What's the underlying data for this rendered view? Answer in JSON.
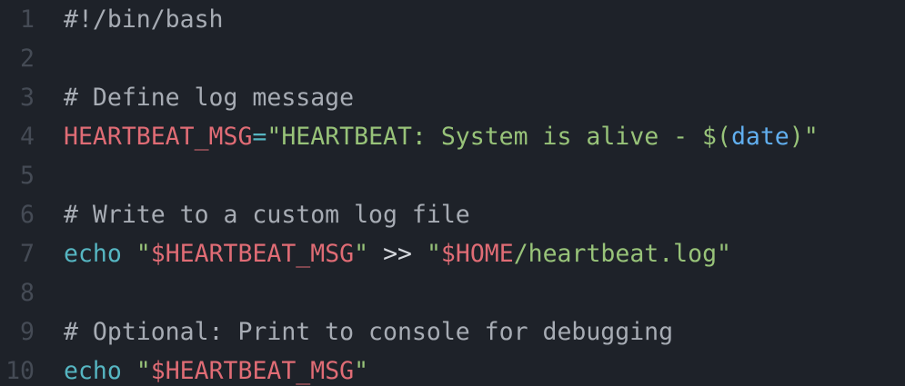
{
  "editor": {
    "lines": [
      {
        "num": "1",
        "tokens": [
          {
            "t": "#!/bin/bash",
            "c": "comment"
          }
        ]
      },
      {
        "num": "2",
        "tokens": []
      },
      {
        "num": "3",
        "tokens": [
          {
            "t": "# Define log message",
            "c": "comment"
          }
        ]
      },
      {
        "num": "4",
        "tokens": [
          {
            "t": "HEARTBEAT_MSG",
            "c": "var"
          },
          {
            "t": "=",
            "c": "op"
          },
          {
            "t": "\"HEARTBEAT: System is alive - $(",
            "c": "str"
          },
          {
            "t": "date",
            "c": "fn"
          },
          {
            "t": ")\"",
            "c": "str"
          }
        ]
      },
      {
        "num": "5",
        "tokens": []
      },
      {
        "num": "6",
        "tokens": [
          {
            "t": "# Write to a custom log file",
            "c": "comment"
          }
        ]
      },
      {
        "num": "7",
        "tokens": [
          {
            "t": "echo",
            "c": "kw"
          },
          {
            "t": " ",
            "c": "plain"
          },
          {
            "t": "\"",
            "c": "str"
          },
          {
            "t": "$HEARTBEAT_MSG",
            "c": "var"
          },
          {
            "t": "\"",
            "c": "str"
          },
          {
            "t": " >> ",
            "c": "plain"
          },
          {
            "t": "\"",
            "c": "str"
          },
          {
            "t": "$HOME",
            "c": "var"
          },
          {
            "t": "/heartbeat.log\"",
            "c": "str"
          }
        ]
      },
      {
        "num": "8",
        "tokens": []
      },
      {
        "num": "9",
        "tokens": [
          {
            "t": "# Optional: Print to console for debugging",
            "c": "comment"
          }
        ]
      },
      {
        "num": "10",
        "tokens": [
          {
            "t": "echo",
            "c": "kw"
          },
          {
            "t": " ",
            "c": "plain"
          },
          {
            "t": "\"",
            "c": "str"
          },
          {
            "t": "$HEARTBEAT_MSG",
            "c": "var"
          },
          {
            "t": "\"",
            "c": "str"
          }
        ]
      }
    ]
  }
}
